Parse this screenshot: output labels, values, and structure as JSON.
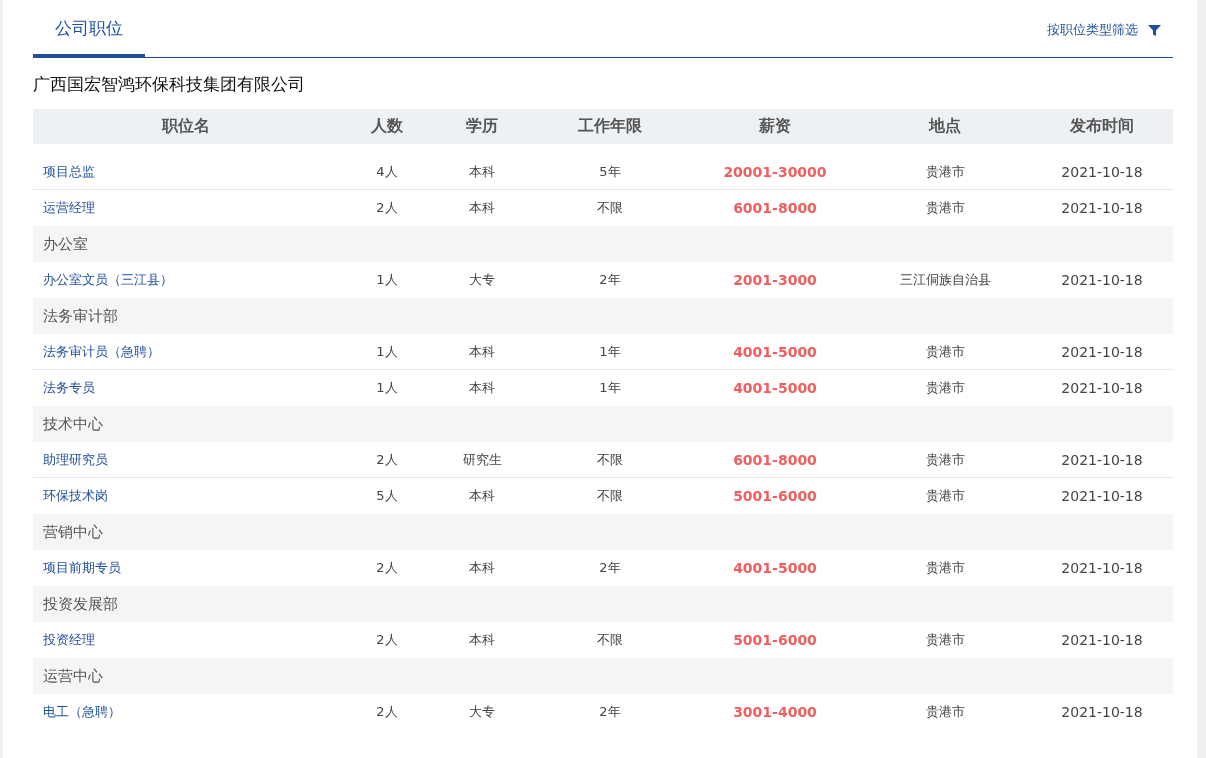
{
  "tabs": [
    {
      "label": "公司职位",
      "selected": true
    }
  ],
  "filter": {
    "label": "按职位类型筛选"
  },
  "company": "广西国宏智鸿环保科技集团有限公司",
  "table": {
    "columns": [
      "职位名",
      "人数",
      "学历",
      "工作年限",
      "薪资",
      "地点",
      "发布时间"
    ],
    "rows": [
      {
        "kind": "job",
        "cells": [
          "项目总监",
          "4人",
          "本科",
          "5年",
          "20001-30000",
          "贵港市",
          "2021-10-18"
        ]
      },
      {
        "kind": "job",
        "cells": [
          "运营经理",
          "2人",
          "本科",
          "不限",
          "6001-8000",
          "贵港市",
          "2021-10-18"
        ]
      },
      {
        "kind": "dept",
        "name": "办公室"
      },
      {
        "kind": "job",
        "cells": [
          "办公室文员（三江县）",
          "1人",
          "大专",
          "2年",
          "2001-3000",
          "三江侗族自治县",
          "2021-10-18"
        ]
      },
      {
        "kind": "dept",
        "name": "法务审计部"
      },
      {
        "kind": "job",
        "cells": [
          "法务审计员（急聘）",
          "1人",
          "本科",
          "1年",
          "4001-5000",
          "贵港市",
          "2021-10-18"
        ]
      },
      {
        "kind": "job",
        "cells": [
          "法务专员",
          "1人",
          "本科",
          "1年",
          "4001-5000",
          "贵港市",
          "2021-10-18"
        ]
      },
      {
        "kind": "dept",
        "name": "技术中心"
      },
      {
        "kind": "job",
        "cells": [
          "助理研究员",
          "2人",
          "研究生",
          "不限",
          "6001-8000",
          "贵港市",
          "2021-10-18"
        ]
      },
      {
        "kind": "job",
        "cells": [
          "环保技术岗",
          "5人",
          "本科",
          "不限",
          "5001-6000",
          "贵港市",
          "2021-10-18"
        ]
      },
      {
        "kind": "dept",
        "name": "营销中心"
      },
      {
        "kind": "job",
        "cells": [
          "项目前期专员",
          "2人",
          "本科",
          "2年",
          "4001-5000",
          "贵港市",
          "2021-10-18"
        ]
      },
      {
        "kind": "dept",
        "name": "投资发展部"
      },
      {
        "kind": "job",
        "cells": [
          "投资经理",
          "2人",
          "本科",
          "不限",
          "5001-6000",
          "贵港市",
          "2021-10-18"
        ]
      },
      {
        "kind": "dept",
        "name": "运营中心"
      },
      {
        "kind": "job",
        "cells": [
          "电工（急聘）",
          "2人",
          "大专",
          "2年",
          "3001-4000",
          "贵港市",
          "2021-10-18"
        ]
      }
    ]
  }
}
